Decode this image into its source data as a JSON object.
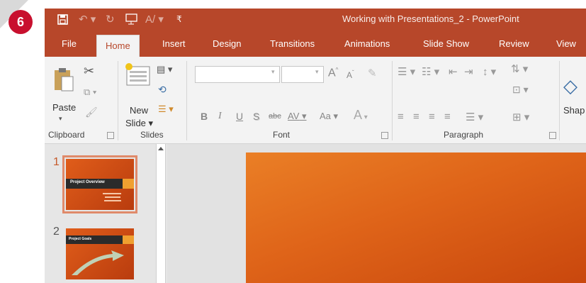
{
  "step_number": "6",
  "titlebar": {
    "title": "Working with Presentations_2 - PowerPoint",
    "qat_icons": [
      "save-icon",
      "undo-icon",
      "redo-icon",
      "start-from-beginning-icon",
      "spelling-icon",
      "customize-qat-icon"
    ]
  },
  "tabs": [
    "File",
    "Home",
    "Insert",
    "Design",
    "Transitions",
    "Animations",
    "Slide Show",
    "Review",
    "View"
  ],
  "active_tab": "Home",
  "ribbon": {
    "clipboard": {
      "paste_label": "Paste",
      "group_label": "Clipboard"
    },
    "slides": {
      "new_slide_line1": "New",
      "new_slide_line2": "Slide",
      "group_label": "Slides"
    },
    "font": {
      "group_label": "Font",
      "font_name": "",
      "font_size": "",
      "bold": "B",
      "italic": "I",
      "underline": "U",
      "shadow": "S",
      "strikethrough": "abc",
      "spacing": "AV",
      "change_case": "Aa",
      "font_color": "A",
      "grow": "A",
      "shrink": "A"
    },
    "paragraph": {
      "group_label": "Paragraph"
    },
    "drawing": {
      "shapes_label": "Shap"
    }
  },
  "slides_pane": {
    "slide1": {
      "number": "1",
      "title": "Project Overview"
    },
    "slide2": {
      "number": "2",
      "title": "Project Goals"
    }
  },
  "colors": {
    "accent": "#b7472a",
    "slide": "#e06a1c",
    "badge": "#c8102e"
  }
}
